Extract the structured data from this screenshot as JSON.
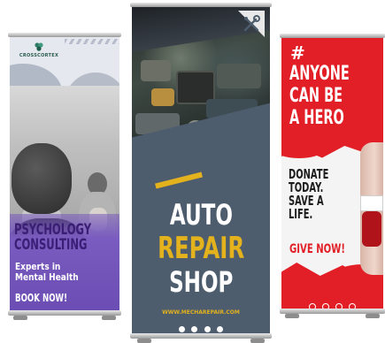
{
  "banners": {
    "left": {
      "logo_text": "CROSSCORTEX",
      "title_line1": "PSYCHOLOGY",
      "title_line2": "CONSULTING",
      "subtitle_line1": "Experts in",
      "subtitle_line2": "Mental Health",
      "cta": "BOOK NOW!",
      "colors": {
        "accent": "#6b4db3",
        "title": "#3a1d74"
      }
    },
    "middle": {
      "title_line1": "AUTO",
      "title_line2": "REPAIR",
      "title_line3": "SHOP",
      "url": "WWW.MECHAREPAIR.COM",
      "icon": "wrench-screwdriver-icon",
      "colors": {
        "accent": "#e3b21d",
        "background": "#4d5d6e"
      }
    },
    "right": {
      "hashtag": "#",
      "title_line1": "ANYONE",
      "title_line2": "CAN BE",
      "title_line3": "A HERO",
      "body_line1": "DONATE",
      "body_line2": "TODAY.",
      "body_line3": "SAVE A",
      "body_line4": "LIFE.",
      "cta": "GIVE NOW!",
      "colors": {
        "accent": "#e21f26"
      }
    }
  }
}
